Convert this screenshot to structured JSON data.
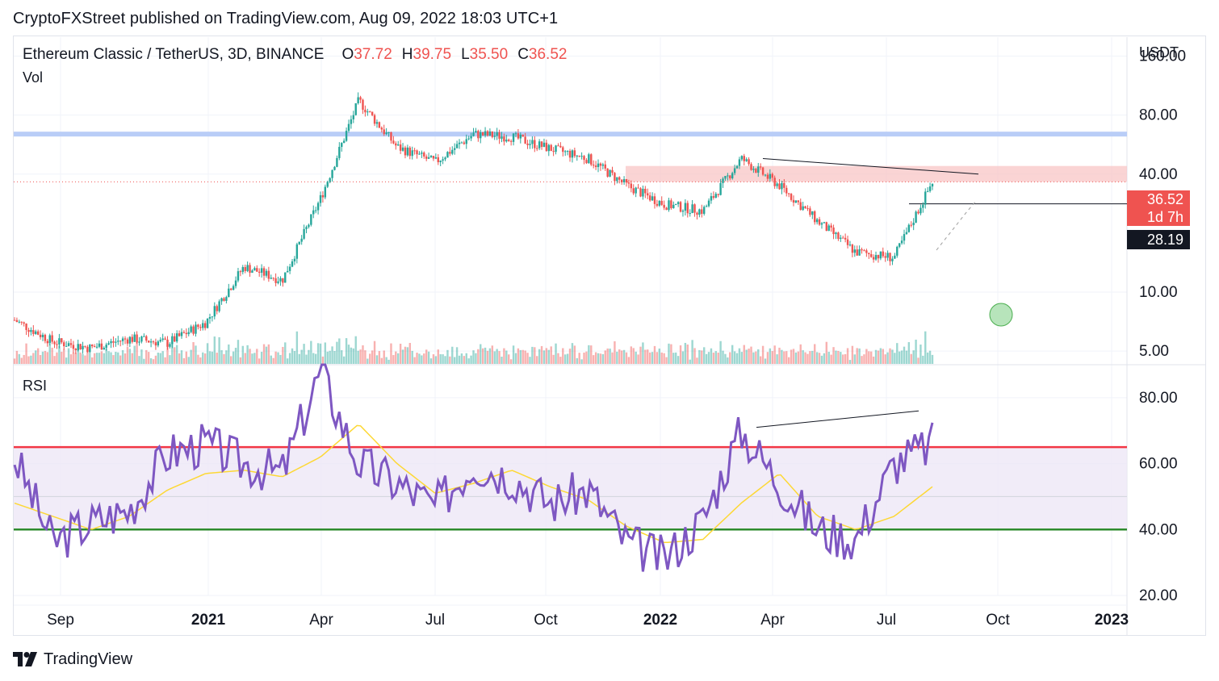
{
  "header": {
    "published": "CryptoFXStreet published on TradingView.com, Aug 09, 2022 18:03 UTC+1"
  },
  "legend": {
    "symbol": "Ethereum Classic / TetherUS, 3D, BINANCE",
    "open_label": "O",
    "open": "37.72",
    "high_label": "H",
    "high": "39.75",
    "low_label": "L",
    "low": "35.50",
    "close_label": "C",
    "close": "36.52",
    "volume_label": "Vol"
  },
  "price_axis": {
    "currency": "USDT",
    "ticks": [
      "160.00",
      "80.00",
      "40.00",
      "10.00",
      "5.00"
    ],
    "last_price": "36.52",
    "countdown": "1d 7h",
    "marker_price": "28.19"
  },
  "rsi_panel": {
    "label": "RSI",
    "ticks": [
      "80.00",
      "60.00",
      "40.00",
      "20.00"
    ]
  },
  "time_axis": [
    "Sep",
    "2021",
    "Apr",
    "Jul",
    "Oct",
    "2022",
    "Apr",
    "Jul",
    "Oct",
    "2023"
  ],
  "footer": {
    "brand": "TradingView"
  },
  "colors": {
    "up": "#26a69a",
    "down": "#ef5350",
    "rsi": "#7e57c2",
    "rsi_ma": "#fdd835",
    "overbought": "#f23645",
    "oversold": "#2e8b2e",
    "resistance_zone": "#f8c6c6",
    "support_band": "#b9cdf7"
  },
  "chart_data": [
    {
      "type": "line",
      "title": "Ethereum Classic / TetherUS, 3D, BINANCE",
      "scale": "log",
      "ylim": [
        4.3,
        200
      ],
      "x": [
        "2020-08",
        "2020-09",
        "2020-10",
        "2020-11",
        "2020-12",
        "2021-01",
        "2021-02",
        "2021-03",
        "2021-04",
        "2021-05",
        "2021-06",
        "2021-07",
        "2021-08",
        "2021-09",
        "2021-10",
        "2021-11",
        "2021-12",
        "2022-01",
        "2022-02",
        "2022-03",
        "2022-04",
        "2022-05",
        "2022-06",
        "2022-07",
        "2022-08"
      ],
      "series": [
        {
          "values": [
            7.2,
            5.6,
            5.2,
            5.8,
            5.5,
            7.0,
            13.5,
            11.5,
            30,
            95,
            55,
            46,
            64,
            62,
            54,
            48,
            35,
            28,
            26,
            48,
            35,
            23,
            16,
            15,
            36.5
          ]
        }
      ],
      "annotations": {
        "resistance_zone": [
          36.5,
          44
        ],
        "horizontal_level": 28.19,
        "support_band": 64
      }
    },
    {
      "type": "line",
      "title": "RSI",
      "ylim": [
        20,
        90
      ],
      "levels": {
        "overbought": 65,
        "oversold": 40
      },
      "x": [
        "2020-08",
        "2020-09",
        "2020-10",
        "2020-11",
        "2020-12",
        "2021-01",
        "2021-02",
        "2021-03",
        "2021-04",
        "2021-05",
        "2021-06",
        "2021-07",
        "2021-08",
        "2021-09",
        "2021-10",
        "2021-11",
        "2021-12",
        "2022-01",
        "2022-02",
        "2022-03",
        "2022-04",
        "2022-05",
        "2022-06",
        "2022-07",
        "2022-08"
      ],
      "series": [
        {
          "values": [
            62,
            36,
            42,
            46,
            63,
            66,
            60,
            57,
            88,
            60,
            54,
            47,
            60,
            56,
            48,
            52,
            36,
            31,
            43,
            70,
            54,
            40,
            37,
            60,
            66
          ]
        },
        {
          "values": [
            48,
            44,
            40,
            44,
            52,
            57,
            58,
            56,
            62,
            72,
            60,
            51,
            54,
            58,
            53,
            49,
            41,
            36,
            37,
            48,
            57,
            44,
            40,
            44,
            53
          ]
        }
      ]
    }
  ]
}
